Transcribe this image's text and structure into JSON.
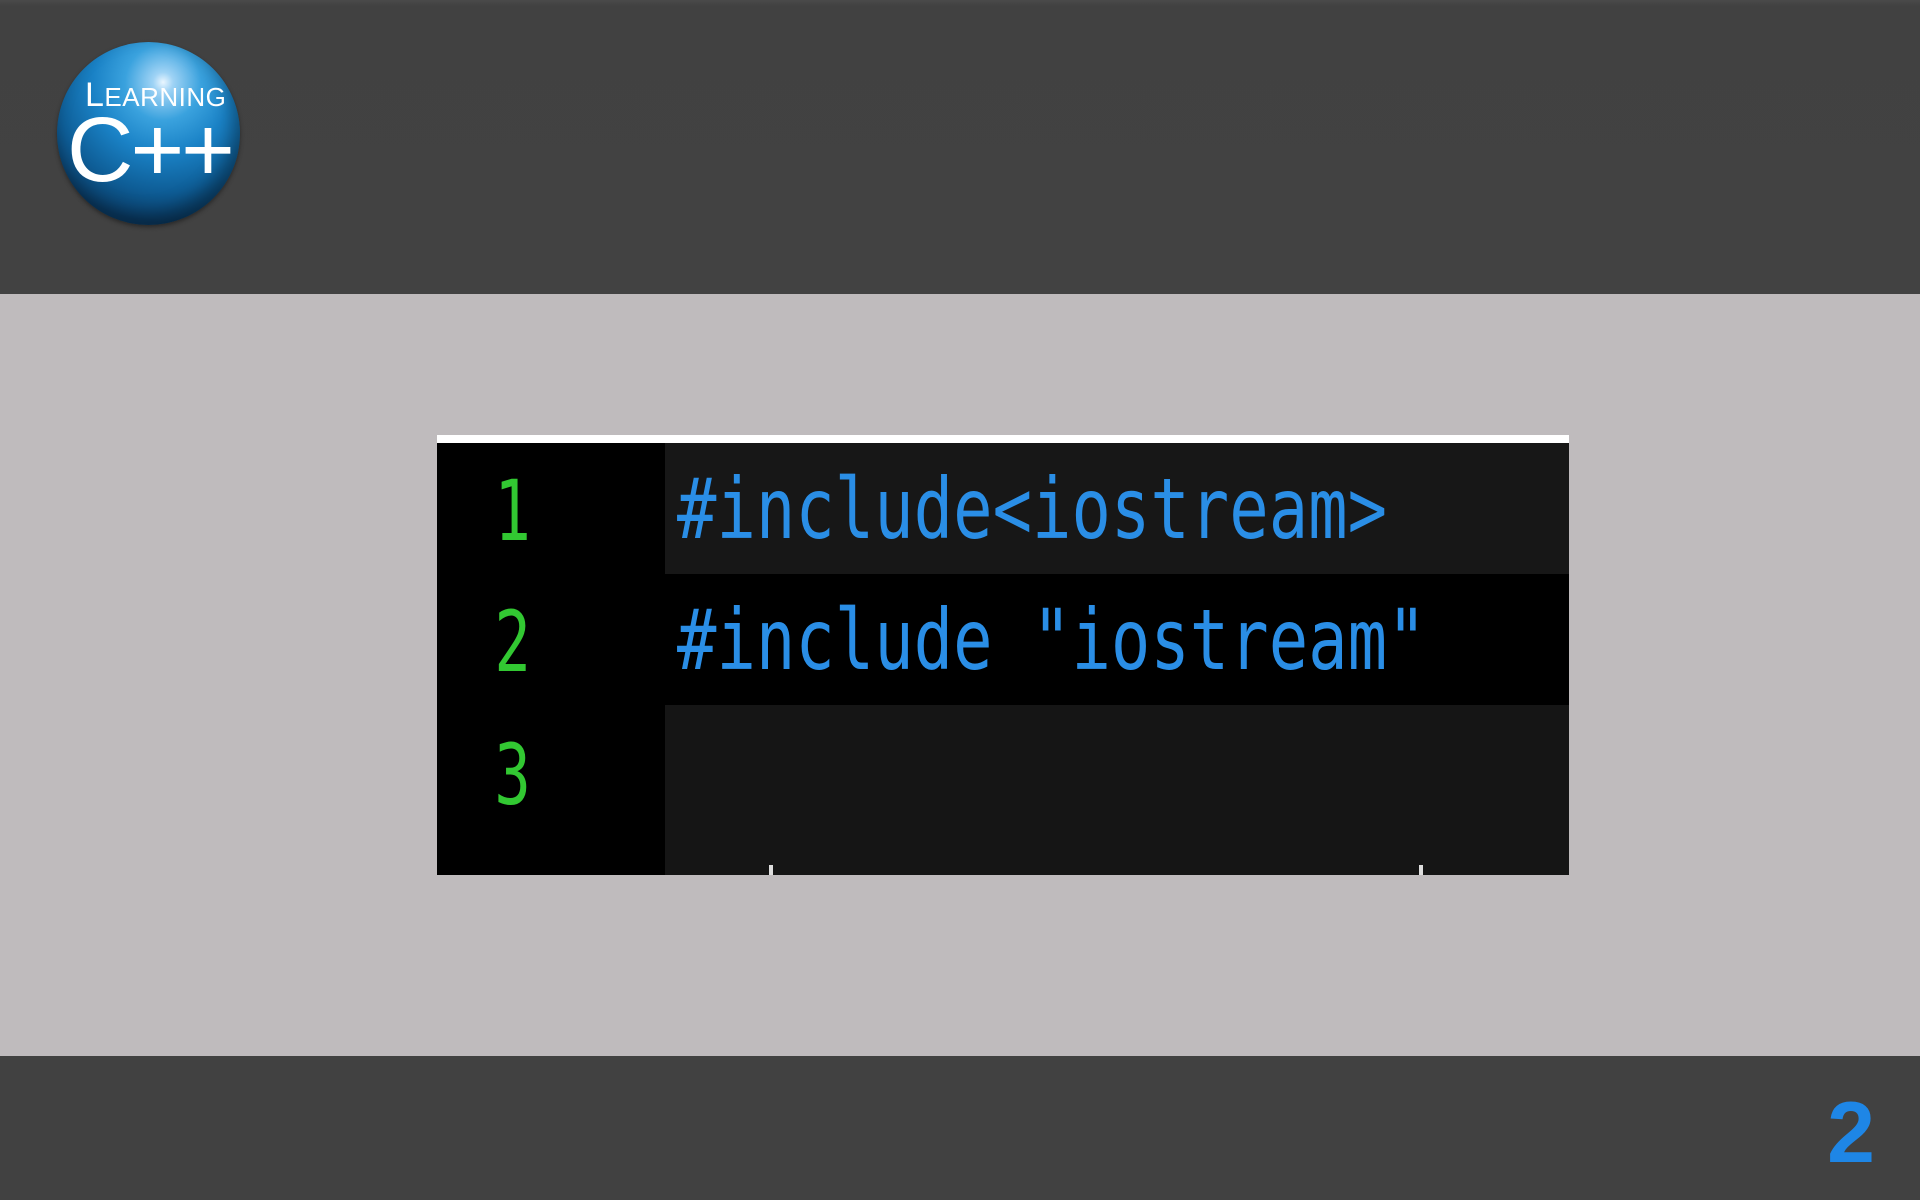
{
  "logo": {
    "top_first": "L",
    "top_rest": "EARNING",
    "main": "C++"
  },
  "code": {
    "lines": [
      {
        "number": "1",
        "text": "#include<iostream>"
      },
      {
        "number": "2",
        "text": "#include \"iostream\""
      },
      {
        "number": "3",
        "text": ""
      }
    ]
  },
  "slide_number": "2",
  "colors": {
    "line_number": "#32c832",
    "code_text": "#2a8ee6",
    "slide_number": "#1e86e6"
  }
}
